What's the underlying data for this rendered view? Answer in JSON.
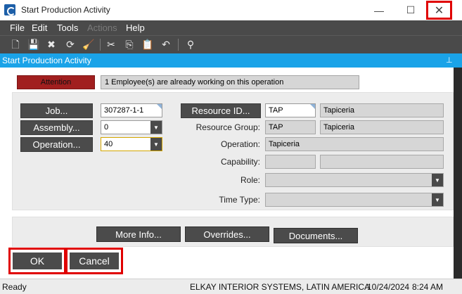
{
  "window": {
    "title": "Start Production Activity",
    "minimize": "—",
    "maximize": "☐",
    "close": "✕"
  },
  "menu": [
    {
      "label": "File",
      "enabled": true
    },
    {
      "label": "Edit",
      "enabled": true
    },
    {
      "label": "Tools",
      "enabled": true
    },
    {
      "label": "Actions",
      "enabled": false
    },
    {
      "label": "Help",
      "enabled": true
    }
  ],
  "toolbar": {
    "new": "🗋",
    "save": "💾",
    "delete": "✖",
    "refresh": "⟳",
    "clear": "🧹",
    "cut": "✂",
    "copy": "⎘",
    "paste": "📋",
    "undo": "↶",
    "search": "⚲"
  },
  "panel": {
    "title": "Start Production Activity",
    "pin": "⊥"
  },
  "attention": {
    "label": "Attention",
    "message": "1 Employee(s) are already working on this operation"
  },
  "form": {
    "job_label": "Job...",
    "job_value": "307287-1-1",
    "assembly_label": "Assembly...",
    "assembly_value": "0",
    "operation_left_label": "Operation...",
    "operation_left_value": "40",
    "resource_id_label": "Resource ID...",
    "resource_id_value": "TAP",
    "resource_id_desc": "Tapiceria",
    "resource_group_label": "Resource Group:",
    "resource_group_value": "TAP",
    "resource_group_desc": "Tapiceria",
    "operation_label": "Operation:",
    "operation_value": "Tapiceria",
    "capability_label": "Capability:",
    "capability_value": "",
    "capability_desc": "",
    "role_label": "Role:",
    "role_value": "",
    "time_type_label": "Time Type:",
    "time_type_value": ""
  },
  "actions": {
    "more_info": "More Info...",
    "overrides": "Overrides...",
    "documents": "Documents..."
  },
  "dialog": {
    "ok": "OK",
    "cancel": "Cancel"
  },
  "status": {
    "state": "Ready",
    "company": "ELKAY INTERIOR SYSTEMS, LATIN AMERICA",
    "date": "10/24/2024",
    "time": "8:24 AM"
  },
  "colors": {
    "accent": "#1aa3e8",
    "toolbar": "#4a4a4a",
    "attention": "#a11f1f",
    "highlight": "#e00000"
  }
}
